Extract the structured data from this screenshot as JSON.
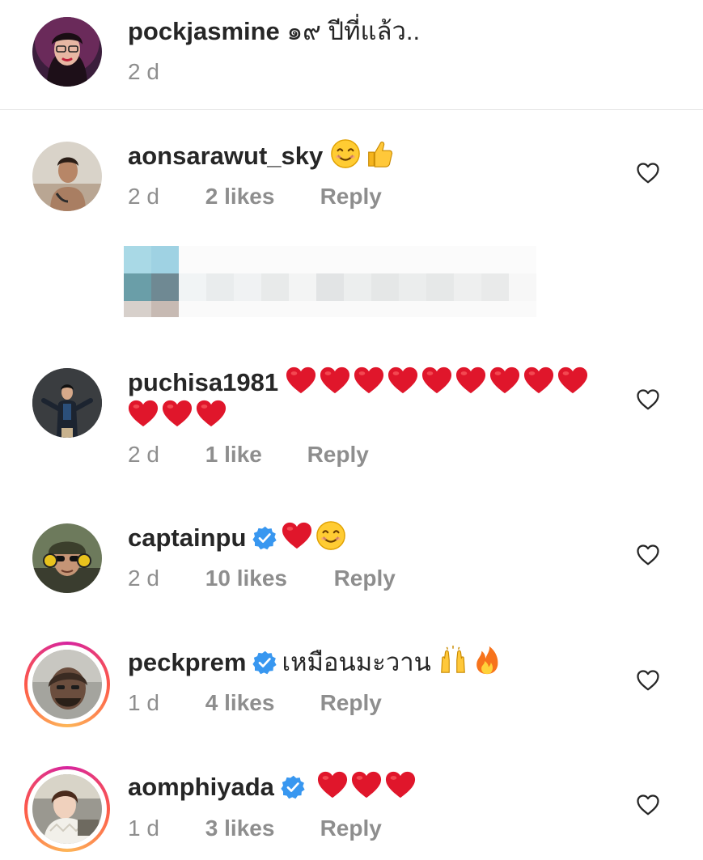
{
  "caption": {
    "username": "pockjasmine",
    "text": "๑๙ ปีที่แล้ว..",
    "time": "2 d"
  },
  "comments": [
    {
      "username": "aonsarawut_sky",
      "verified": false,
      "text": "",
      "emoji": [
        "smile-emoji",
        "thumbs-up-emoji"
      ],
      "time": "2 d",
      "likes": "2 likes",
      "reply": "Reply"
    },
    {
      "username": "puchisa1981",
      "verified": false,
      "text": "",
      "emoji_line1": [
        "heart",
        "heart",
        "heart",
        "heart",
        "heart",
        "heart",
        "heart",
        "heart",
        "heart"
      ],
      "emoji_line2": [
        "heart",
        "heart",
        "heart"
      ],
      "time": "2 d",
      "likes": "1 like",
      "reply": "Reply"
    },
    {
      "username": "captainpu",
      "verified": true,
      "text": "",
      "emoji": [
        "heart-emoji",
        "smile-emoji"
      ],
      "time": "2 d",
      "likes": "10 likes",
      "reply": "Reply"
    },
    {
      "username": "peckprem",
      "verified": true,
      "text": "เหมือนมะวาน",
      "emoji": [
        "raised-hands-emoji",
        "fire-emoji"
      ],
      "time": "1 d",
      "likes": "4 likes",
      "reply": "Reply"
    },
    {
      "username": "aomphiyada",
      "verified": true,
      "text": "",
      "emoji": [
        "heart-emoji",
        "heart-emoji",
        "heart-emoji"
      ],
      "time": "1 d",
      "likes": "3 likes",
      "reply": "Reply"
    }
  ],
  "colors": {
    "text": "#262626",
    "meta": "#8e8e8e",
    "verified": "#3897f0",
    "heart": "#e0162b",
    "divider": "#e6e6e6"
  }
}
